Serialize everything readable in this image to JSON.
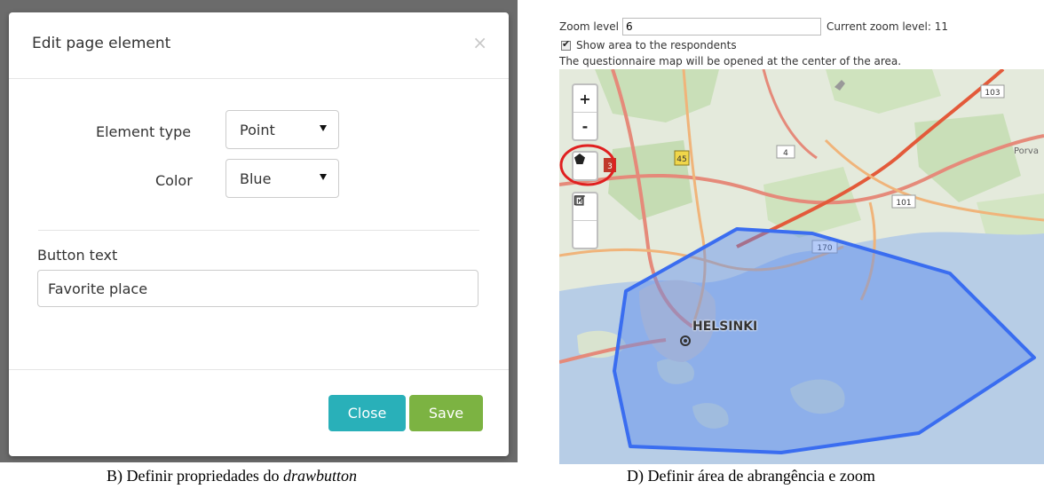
{
  "modal": {
    "title": "Edit page element",
    "close_symbol": "×",
    "element_type_label": "Element type",
    "element_type_value": "Point",
    "color_label": "Color",
    "color_value": "Blue",
    "button_text_label": "Button text",
    "button_text_value": "Favorite place",
    "close_button": "Close",
    "save_button": "Save"
  },
  "map_panel": {
    "zoom_level_label": "Zoom level",
    "zoom_level_value": "6",
    "current_zoom_text": "Current zoom level: 11",
    "show_area_label": "Show area to the respondents",
    "show_area_checked": true,
    "area_note": "The questionnaire map will be opened at the center of the area.",
    "city_label": "HELSINKI",
    "road_labels": [
      "103",
      "45",
      "3",
      "4",
      "101",
      "170"
    ],
    "partial_label": "Porva",
    "controls": {
      "zoom_in": "+",
      "zoom_out": "-",
      "draw_polygon_icon": "pentagon-icon",
      "edit_icon": "edit-icon",
      "delete_icon": "trash-icon"
    },
    "colors": {
      "highlight_circle": "#e02020",
      "area_fill": "#5a8cf0",
      "area_stroke": "#3a6df0"
    }
  },
  "captions": {
    "left_prefix": "B) Definir propriedades do ",
    "left_italic": "drawbutton",
    "right": "D) Definir área de abrangência e zoom"
  }
}
